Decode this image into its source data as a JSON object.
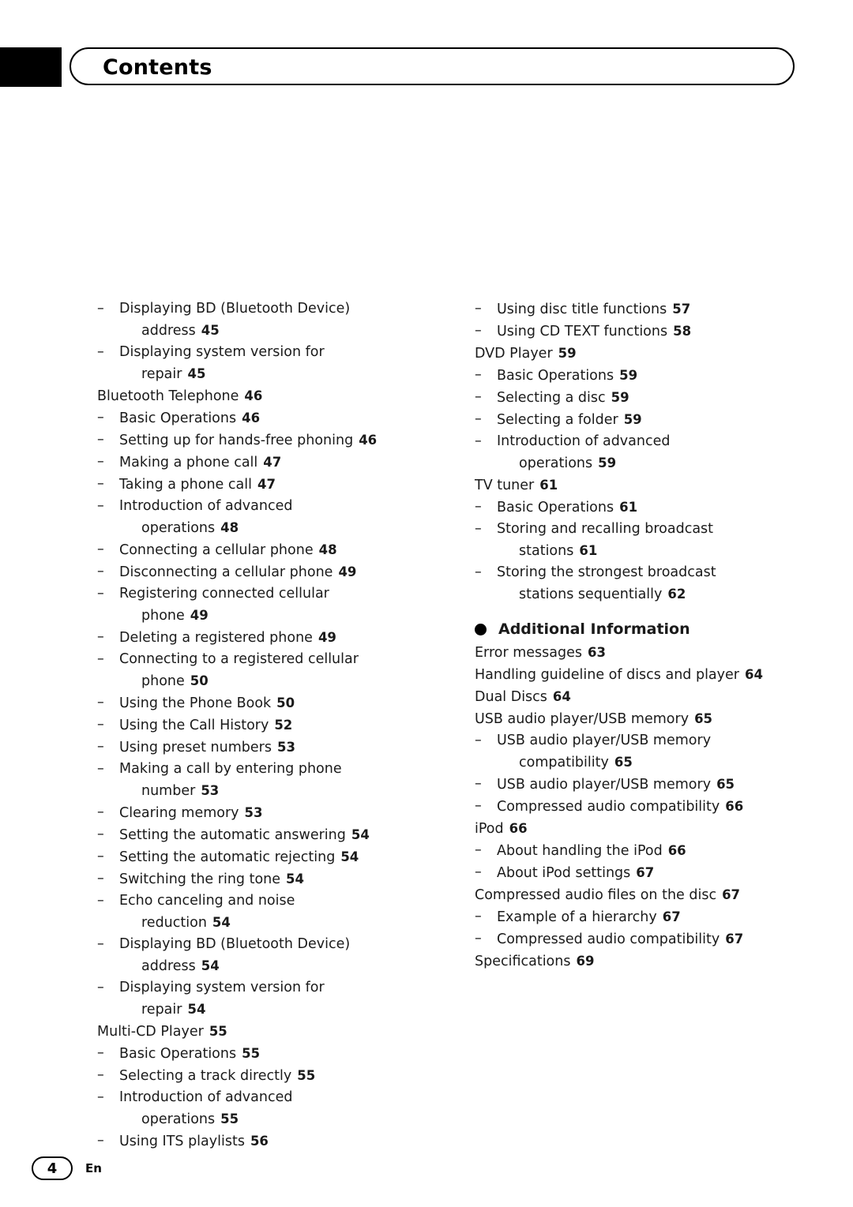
{
  "header": {
    "title": "Contents"
  },
  "footer": {
    "page_number": "4",
    "language": "En"
  },
  "left_column": [
    {
      "level": 1,
      "text": "Displaying BD (Bluetooth Device)",
      "cont": "address",
      "page": "45"
    },
    {
      "level": 1,
      "text": "Displaying system version for",
      "cont": "repair",
      "page": "45"
    },
    {
      "level": 0,
      "text": "Bluetooth Telephone",
      "page": "46"
    },
    {
      "level": 1,
      "text": "Basic Operations",
      "page": "46"
    },
    {
      "level": 1,
      "text": "Setting up for hands-free phoning",
      "page": "46"
    },
    {
      "level": 1,
      "text": "Making a phone call",
      "page": "47"
    },
    {
      "level": 1,
      "text": "Taking a phone call",
      "page": "47"
    },
    {
      "level": 1,
      "text": "Introduction of advanced",
      "cont": "operations",
      "page": "48"
    },
    {
      "level": 1,
      "text": "Connecting a cellular phone",
      "page": "48"
    },
    {
      "level": 1,
      "text": "Disconnecting a cellular phone",
      "page": "49"
    },
    {
      "level": 1,
      "text": "Registering connected cellular",
      "cont": "phone",
      "page": "49"
    },
    {
      "level": 1,
      "text": "Deleting a registered phone",
      "page": "49"
    },
    {
      "level": 1,
      "text": "Connecting to a registered cellular",
      "cont": "phone",
      "page": "50"
    },
    {
      "level": 1,
      "text": "Using the Phone Book",
      "page": "50"
    },
    {
      "level": 1,
      "text": "Using the Call History",
      "page": "52"
    },
    {
      "level": 1,
      "text": "Using preset numbers",
      "page": "53"
    },
    {
      "level": 1,
      "text": "Making a call by entering phone",
      "cont": "number",
      "page": "53"
    },
    {
      "level": 1,
      "text": "Clearing memory",
      "page": "53"
    },
    {
      "level": 1,
      "text": "Setting the automatic answering",
      "page": "54"
    },
    {
      "level": 1,
      "text": "Setting the automatic rejecting",
      "page": "54"
    },
    {
      "level": 1,
      "text": "Switching the ring tone",
      "page": "54"
    },
    {
      "level": 1,
      "text": "Echo canceling and noise",
      "cont": "reduction",
      "page": "54"
    },
    {
      "level": 1,
      "text": "Displaying BD (Bluetooth Device)",
      "cont": "address",
      "page": "54"
    },
    {
      "level": 1,
      "text": "Displaying system version for",
      "cont": "repair",
      "page": "54"
    },
    {
      "level": 0,
      "text": "Multi-CD Player",
      "page": "55"
    },
    {
      "level": 1,
      "text": "Basic Operations",
      "page": "55"
    },
    {
      "level": 1,
      "text": "Selecting a track directly",
      "page": "55"
    },
    {
      "level": 1,
      "text": "Introduction of advanced",
      "cont": "operations",
      "page": "55"
    },
    {
      "level": 1,
      "text": "Using ITS playlists",
      "page": "56"
    }
  ],
  "right_column": [
    {
      "level": 1,
      "text": "Using disc title functions",
      "page": "57"
    },
    {
      "level": 1,
      "text": "Using CD TEXT functions",
      "page": "58"
    },
    {
      "level": 0,
      "text": "DVD Player",
      "page": "59"
    },
    {
      "level": 1,
      "text": "Basic Operations",
      "page": "59"
    },
    {
      "level": 1,
      "text": "Selecting a disc",
      "page": "59"
    },
    {
      "level": 1,
      "text": "Selecting a folder",
      "page": "59"
    },
    {
      "level": 1,
      "text": "Introduction of advanced",
      "cont": "operations",
      "page": "59"
    },
    {
      "level": 0,
      "text": "TV tuner",
      "page": "61"
    },
    {
      "level": 1,
      "text": "Basic Operations",
      "page": "61"
    },
    {
      "level": 1,
      "text": "Storing and recalling broadcast",
      "cont": "stations",
      "page": "61"
    },
    {
      "level": 1,
      "text": "Storing the strongest broadcast",
      "cont": "stations sequentially",
      "page": "62"
    }
  ],
  "right_section": {
    "heading": "Additional Information",
    "entries": [
      {
        "level": 0,
        "text": "Error messages",
        "page": "63"
      },
      {
        "level": 0,
        "text": "Handling guideline of discs and player",
        "page": "64"
      },
      {
        "level": 0,
        "text": "Dual Discs",
        "page": "64"
      },
      {
        "level": 0,
        "text": "USB audio player/USB memory",
        "page": "65"
      },
      {
        "level": 1,
        "text": "USB audio player/USB memory",
        "cont": "compatibility",
        "page": "65"
      },
      {
        "level": 1,
        "text": "USB audio player/USB memory",
        "page": "65"
      },
      {
        "level": 1,
        "text": "Compressed audio compatibility",
        "page": "66"
      },
      {
        "level": 0,
        "text": "iPod",
        "page": "66"
      },
      {
        "level": 1,
        "text": "About handling the iPod",
        "page": "66"
      },
      {
        "level": 1,
        "text": "About iPod settings",
        "page": "67"
      },
      {
        "level": 0,
        "text": "Compressed audio files on the disc",
        "page": "67"
      },
      {
        "level": 1,
        "text": "Example of a hierarchy",
        "page": "67"
      },
      {
        "level": 1,
        "text": "Compressed audio compatibility",
        "page": "67"
      },
      {
        "level": 0,
        "text": "Specifications",
        "page": "69"
      }
    ]
  },
  "icons": {
    "dash": "–",
    "bullet": "bullet-icon"
  }
}
